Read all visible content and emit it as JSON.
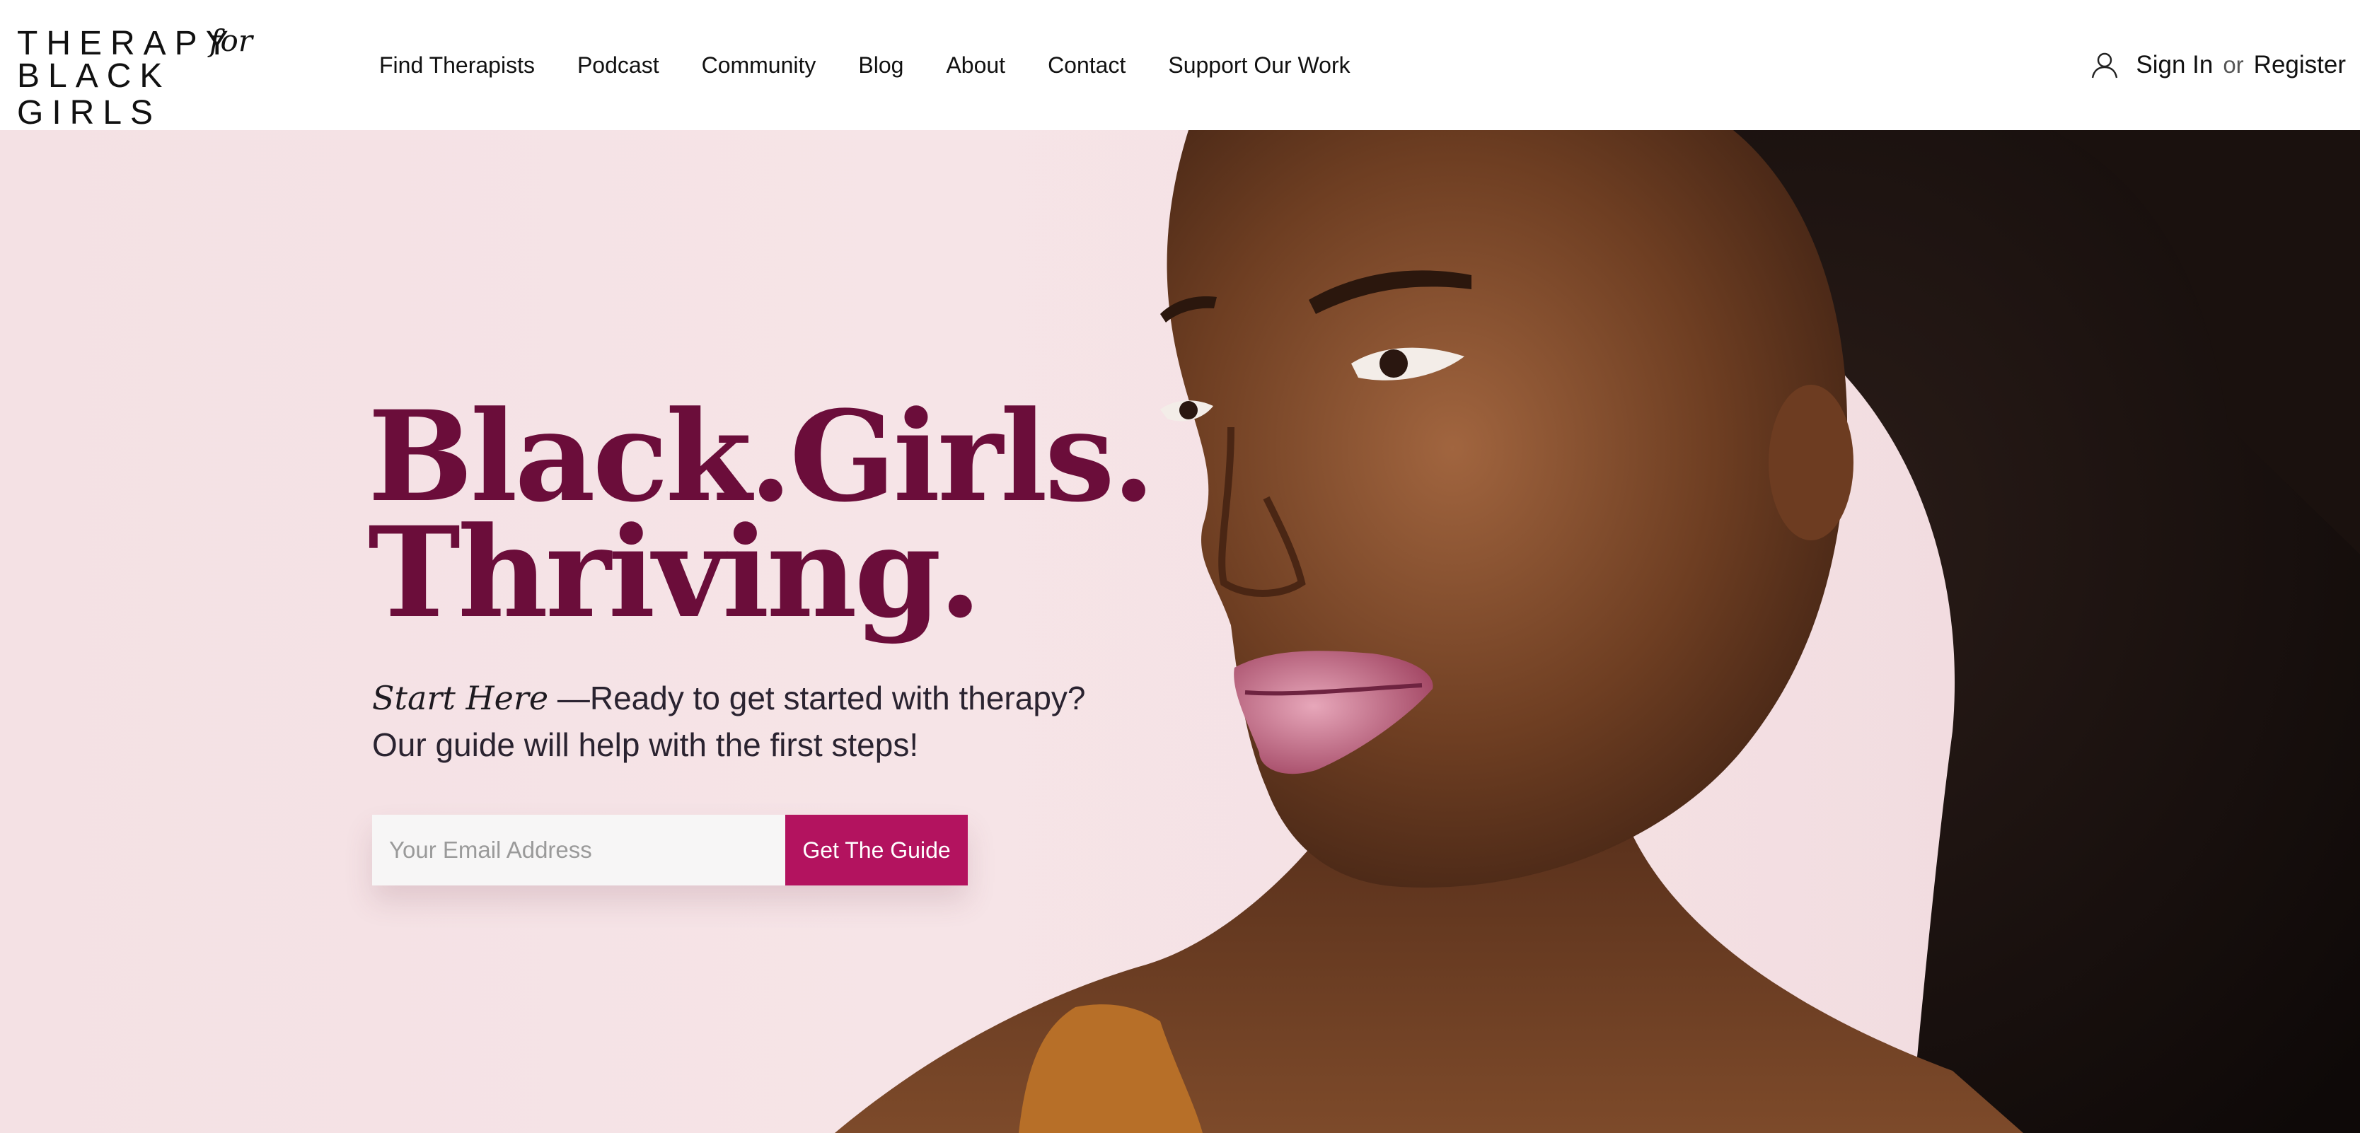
{
  "header": {
    "logo": {
      "line1": "THERAPY",
      "script": "for",
      "line2": "BLACK GIRLS"
    },
    "nav": [
      {
        "label": "Find Therapists"
      },
      {
        "label": "Podcast"
      },
      {
        "label": "Community"
      },
      {
        "label": "Blog"
      },
      {
        "label": "About"
      },
      {
        "label": "Contact"
      },
      {
        "label": "Support Our Work"
      }
    ],
    "account": {
      "icon": "user-icon",
      "sign_in": "Sign In",
      "separator": "or",
      "register": "Register"
    }
  },
  "hero": {
    "headline_line1": "Black.Girls.",
    "headline_line2": "Thriving.",
    "intro_lead": "Start Here",
    "intro_dash": " —",
    "intro_line1": "Ready to get started with therapy?",
    "intro_line2": "Our guide will help with the first steps!",
    "email_placeholder": "Your Email Address",
    "button_label": "Get The Guide"
  },
  "colors": {
    "brand_plum": "#6b0d3a",
    "button_magenta": "#b3135f",
    "hero_background": "#f4e1e4"
  }
}
